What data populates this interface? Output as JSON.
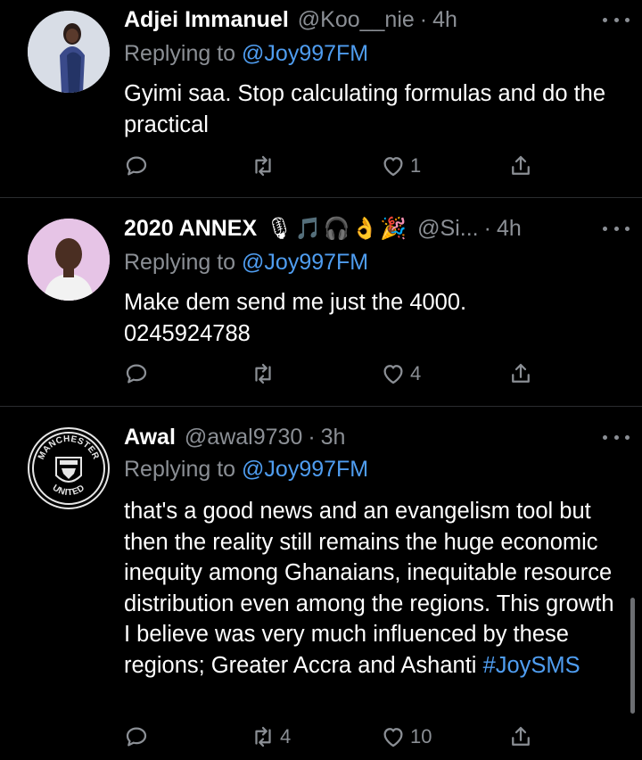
{
  "tweets": [
    {
      "name": "Adjei Immanuel",
      "handle": "@Koo__nie",
      "time": "4h",
      "emojis": "",
      "reply_prefix": "Replying to ",
      "reply_to": "@Joy997FM",
      "text": "Gyimi saa. Stop calculating formulas and do the practical",
      "hashtag": "",
      "retweets": "",
      "likes": "1",
      "avatar_icon": "woman-portrait-avatar"
    },
    {
      "name": "2020 ANNEX",
      "handle": "@Si...",
      "time": "4h",
      "emojis": "🎙🎵🎧👌🎉",
      "reply_prefix": "Replying to ",
      "reply_to": "@Joy997FM",
      "text": "Make dem send me just the 4000.\n0245924788",
      "hashtag": "",
      "retweets": "",
      "likes": "4",
      "avatar_icon": "man-portrait-avatar"
    },
    {
      "name": "Awal",
      "handle": "@awal9730",
      "time": "3h",
      "emojis": "",
      "reply_prefix": "Replying to ",
      "reply_to": "@Joy997FM",
      "text": "that's a good news and an evangelism tool but then the reality still remains the huge economic inequity among Ghanaians, inequitable resource distribution even among the regions. This growth I believe was very much influenced by these regions; Greater Accra and Ashanti ",
      "hashtag": "#JoySMS",
      "retweets": "4",
      "likes": "10",
      "avatar_icon": "manchester-united-crest",
      "crest_top": "MANCHESTER",
      "crest_bottom": "UNITED"
    }
  ],
  "dot_separator": "·",
  "colors": {
    "background": "#000000",
    "muted": "#8b8f95",
    "link": "#4f9df0",
    "divider": "#2a2c2f"
  }
}
